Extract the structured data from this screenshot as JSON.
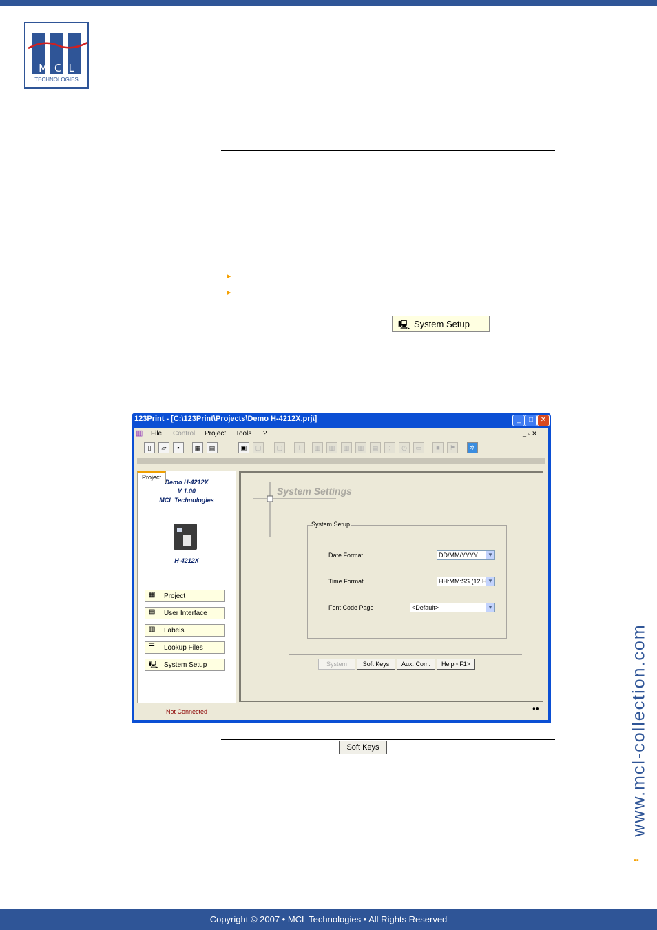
{
  "logo": {
    "letters": "MCL",
    "subtitle": "TECHNOLOGIES"
  },
  "bullets": [
    "",
    ""
  ],
  "system_setup_button": {
    "label": "System Setup"
  },
  "app": {
    "title": "123Print - [C:\\123Print\\Projects\\Demo H-4212X.prj\\]",
    "menu": [
      "File",
      "Control",
      "Project",
      "Tools",
      "?"
    ],
    "tab": "Project",
    "project_name": "Demo H-4212X",
    "version": "V 1.00",
    "company": "MCL Technologies",
    "model": "H-4212X",
    "nav": [
      "Project",
      "User Interface",
      "Labels",
      "Lookup Files",
      "System Setup"
    ],
    "status": "Not Connected",
    "panel_title": "System Settings",
    "group_label": "System Setup",
    "fields": [
      {
        "label": "Date Format",
        "value": "DD/MM/YYYY"
      },
      {
        "label": "Time Format",
        "value": "HH:MM:SS (12 H)"
      },
      {
        "label": "Font Code Page",
        "value": "<Default>"
      }
    ],
    "buttons": [
      "System",
      "Soft Keys",
      "Aux. Com.",
      "Help <F1>"
    ]
  },
  "soft_keys_button": {
    "label": "Soft Keys"
  },
  "side_url": "www.mcl-collection.com",
  "footer": "Copyright © 2007 • MCL Technologies • All Rights Reserved",
  "colors": {
    "brand": "#2f5597",
    "accent": "#f5a000"
  }
}
